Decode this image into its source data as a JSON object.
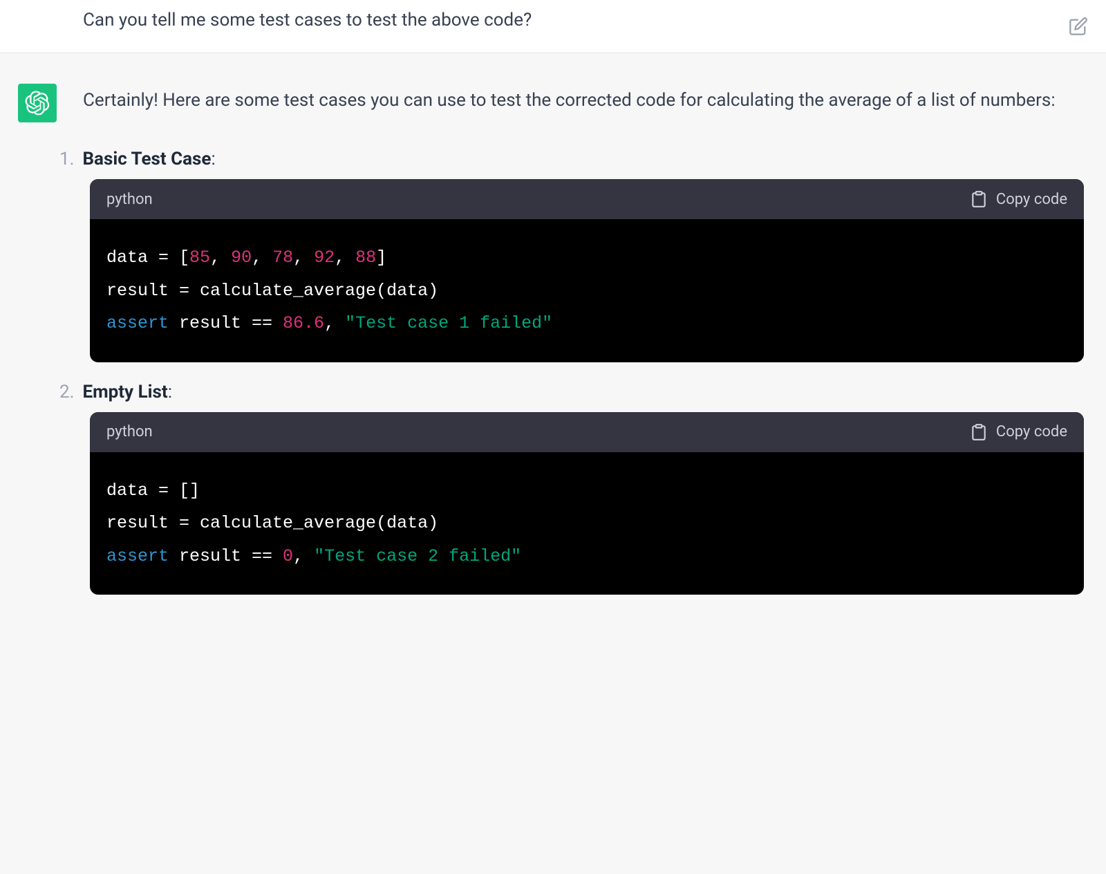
{
  "user": {
    "question": "Can you tell me some test cases to test the above code?"
  },
  "assistant": {
    "intro": "Certainly! Here are some test cases you can use to test the corrected code for calculating the average of a list of numbers:",
    "items": [
      {
        "number": "1.",
        "title": "Basic Test Case",
        "colon": ":",
        "lang": "python",
        "copy": "Copy code",
        "code": {
          "line1_prefix": "data = [",
          "nums": [
            "85",
            "90",
            "78",
            "92",
            "88"
          ],
          "line1_suffix": "]",
          "line2": "result = calculate_average(data)",
          "assert_kw": "assert",
          "assert_mid": " result == ",
          "assert_val": "86.6",
          "assert_comma": ", ",
          "assert_str": "\"Test case 1 failed\""
        }
      },
      {
        "number": "2.",
        "title": "Empty List",
        "colon": ":",
        "lang": "python",
        "copy": "Copy code",
        "code": {
          "line1": "data = []",
          "line2": "result = calculate_average(data)",
          "assert_kw": "assert",
          "assert_mid": " result == ",
          "assert_val": "0",
          "assert_comma": ", ",
          "assert_str": "\"Test case 2 failed\""
        }
      }
    ]
  }
}
